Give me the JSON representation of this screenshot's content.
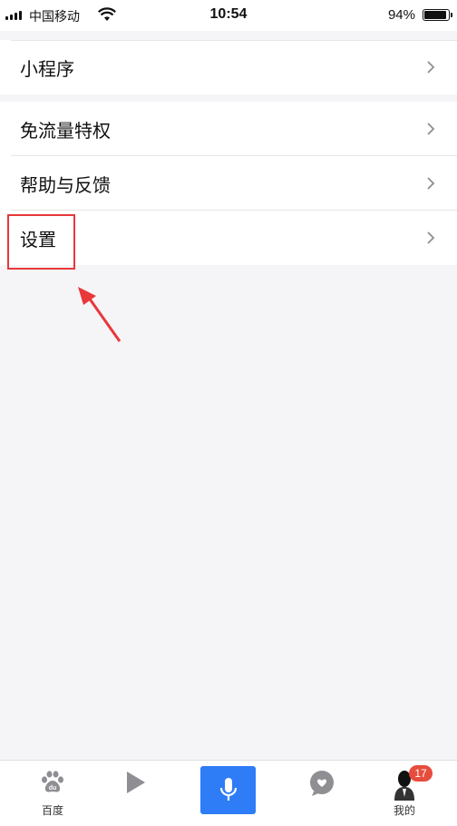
{
  "status_bar": {
    "carrier": "中国移动",
    "time": "10:54",
    "battery_percent": "94%",
    "battery_level": 0.94
  },
  "menu": {
    "mini_program": "小程序",
    "free_traffic": "免流量特权",
    "help_feedback": "帮助与反馈",
    "settings": "设置"
  },
  "tabbar": {
    "tabs": [
      {
        "label": "百度",
        "icon": "baidu-paw-icon"
      },
      {
        "label": "",
        "icon": "video-play-icon"
      },
      {
        "label": "",
        "icon": "microphone-icon"
      },
      {
        "label": "",
        "icon": "chat-bubble-heart-icon"
      },
      {
        "label": "我的",
        "icon": "user-avatar-icon"
      }
    ],
    "badge": "17",
    "voice_color": "#2e7cf6"
  },
  "annotation": {
    "highlight_color": "#e8383a"
  }
}
